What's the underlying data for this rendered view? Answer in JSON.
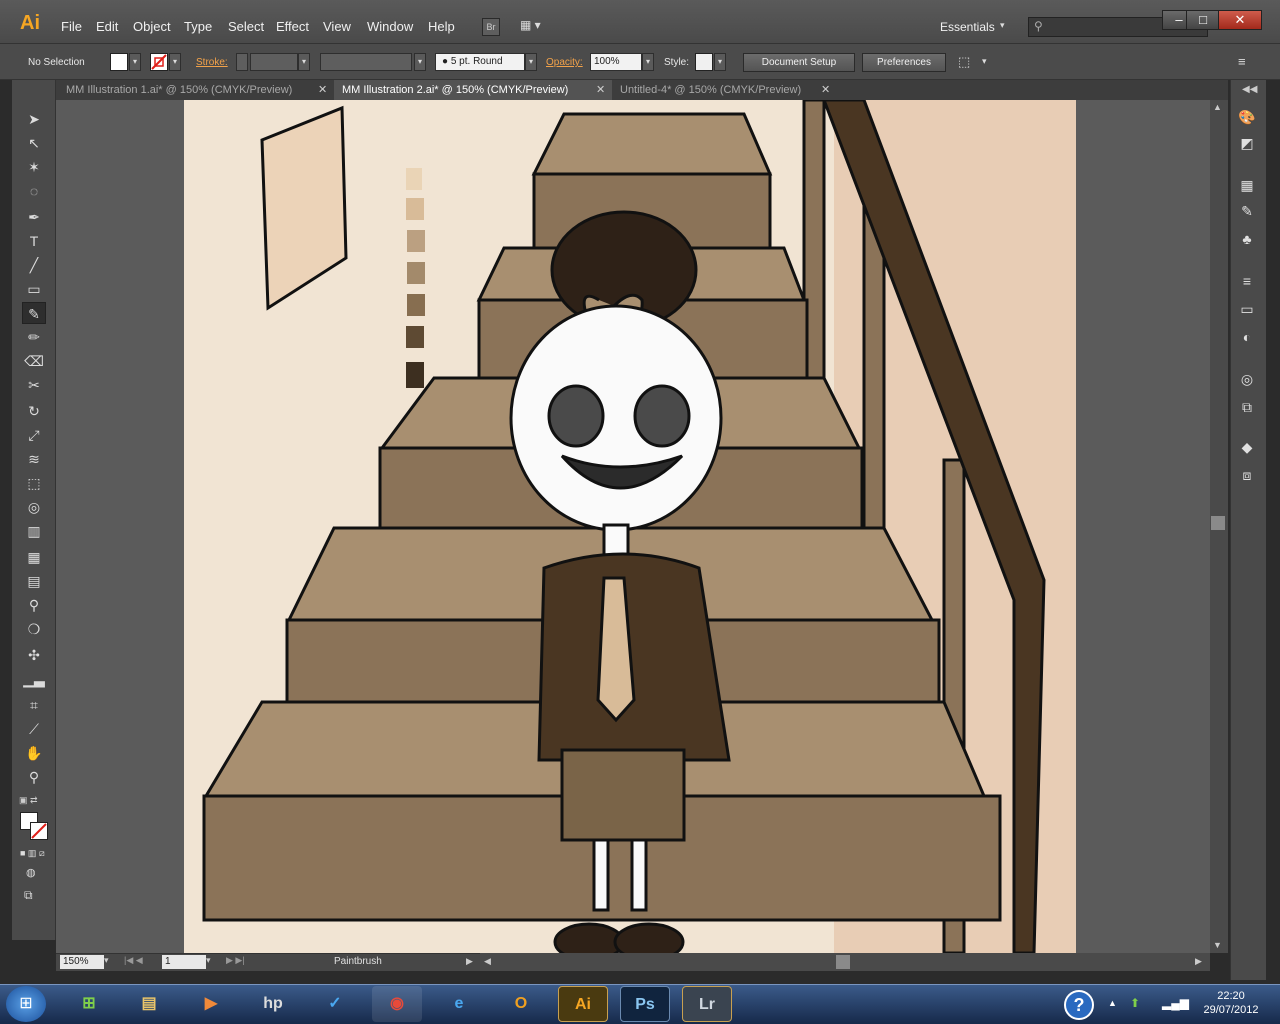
{
  "app": {
    "logo": "Ai",
    "menu": [
      "File",
      "Edit",
      "Object",
      "Type",
      "Select",
      "Effect",
      "View",
      "Window",
      "Help"
    ],
    "bridge_label": "Br",
    "workspace_label": "Essentials",
    "search_placeholder": "",
    "window_controls": [
      "–",
      "□",
      "✕"
    ]
  },
  "control_bar": {
    "selection_label": "No Selection",
    "stroke_label": "Stroke:",
    "brush_label": "5 pt. Round",
    "opacity_label": "Opacity:",
    "opacity_value": "100%",
    "style_label": "Style:",
    "document_setup_label": "Document Setup",
    "preferences_label": "Preferences"
  },
  "tabs": [
    {
      "label": "MM Illustration 1.ai* @ 150% (CMYK/Preview)",
      "active": false
    },
    {
      "label": "MM Illustration 2.ai* @ 150% (CMYK/Preview)",
      "active": true
    },
    {
      "label": "Untitled-4* @ 150% (CMYK/Preview)",
      "active": false
    }
  ],
  "status_bar": {
    "zoom_value": "150%",
    "artboard_value": "1",
    "current_tool": "Paintbrush"
  },
  "taskbar": {
    "time": "22:20",
    "date": "29/07/2012",
    "apps": [
      "Ai",
      "Ps",
      "Lr"
    ],
    "help_icon": "?"
  },
  "colors": {
    "accent_orange": "#f2a24a",
    "stair_light": "#a88f70",
    "stair_dark": "#8b7358",
    "rail": "#4a3622",
    "wall": "#f0e2d2"
  }
}
